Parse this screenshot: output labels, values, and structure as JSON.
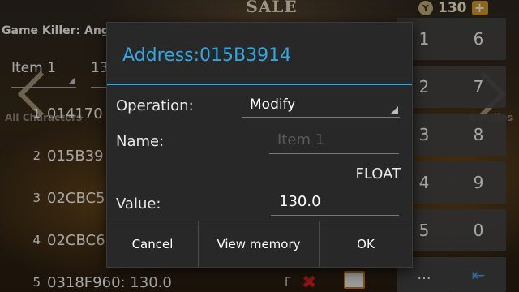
{
  "game": {
    "title": "SALE",
    "coin_icon": "Y",
    "coins": "130",
    "plus": "+",
    "side_left": "All Characters",
    "side_right": "Bundles"
  },
  "gamekiller": {
    "title": "Game Killer: Angr",
    "filter": "Item 1",
    "filter2": "13",
    "rows": [
      {
        "num": "1",
        "addr": "014170"
      },
      {
        "num": "2",
        "addr": "015B39"
      },
      {
        "num": "3",
        "addr": "02CBC5"
      },
      {
        "num": "4",
        "addr": "02CBC6"
      },
      {
        "num": "5",
        "addr": "0318F960: 130.0",
        "flag": "F",
        "delete_icon": "✖"
      }
    ]
  },
  "keypad": {
    "keys": [
      "1",
      "6",
      "2",
      "7",
      "3",
      "8",
      "4",
      "9",
      "5",
      "0",
      "...",
      "⇤"
    ]
  },
  "dialog": {
    "title": "Address:015B3914",
    "operation_label": "Operation:",
    "operation_value": "Modify",
    "name_label": "Name:",
    "name_placeholder": "Item 1",
    "type": "FLOAT",
    "value_label": "Value:",
    "value": "130.0",
    "buttons": {
      "cancel": "Cancel",
      "view_memory": "View memory",
      "ok": "OK"
    }
  },
  "colors": {
    "accent": "#33a7e0",
    "dialog_bg": "#282828",
    "delete": "#e02020"
  }
}
